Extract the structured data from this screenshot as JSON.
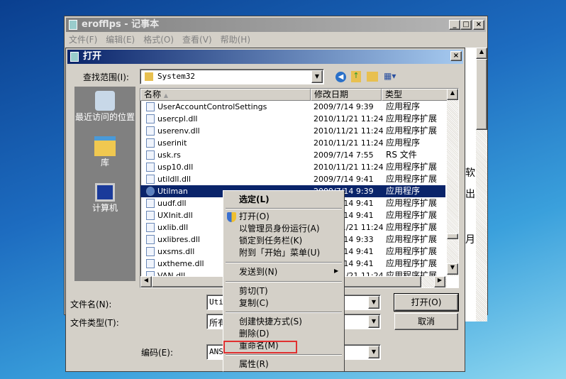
{
  "notepad": {
    "title": "erofflps - 记事本",
    "menu": [
      "文件(F)",
      "编辑(E)",
      "格式(O)",
      "查看(V)",
      "帮助(H)"
    ],
    "bg_text": [
      "软",
      "出",
      "月"
    ]
  },
  "dialog": {
    "title": "打开",
    "look_in_label": "查找范围(I):",
    "look_in_value": "System32",
    "places": [
      "最近访问的位置",
      "库",
      "计算机"
    ],
    "columns": [
      "名称",
      "修改日期",
      "类型"
    ],
    "files": [
      {
        "name": "UserAccountControlSettings",
        "date": "2009/7/14 9:39",
        "type": "应用程序",
        "icon": "uac-shield-icon"
      },
      {
        "name": "usercpl.dll",
        "date": "2010/11/21 11:24",
        "type": "应用程序扩展",
        "icon": "dll-icon"
      },
      {
        "name": "userenv.dll",
        "date": "2010/11/21 11:24",
        "type": "应用程序扩展",
        "icon": "dll-icon"
      },
      {
        "name": "userinit",
        "date": "2010/11/21 11:24",
        "type": "应用程序",
        "icon": "exe-icon"
      },
      {
        "name": "usk.rs",
        "date": "2009/7/14 7:55",
        "type": "RS 文件",
        "icon": "file-icon"
      },
      {
        "name": "usp10.dll",
        "date": "2010/11/21 11:24",
        "type": "应用程序扩展",
        "icon": "dll-icon"
      },
      {
        "name": "utildll.dll",
        "date": "2009/7/14 9:41",
        "type": "应用程序扩展",
        "icon": "dll-icon"
      },
      {
        "name": "Utilman",
        "date": "2009/7/14 9:39",
        "type": "应用程序",
        "icon": "utilman-icon"
      },
      {
        "name": "uudf.dll",
        "date": "2009/7/14 9:41",
        "type": "应用程序扩展",
        "icon": "dll-icon"
      },
      {
        "name": "UXInit.dll",
        "date": "2009/7/14 9:41",
        "type": "应用程序扩展",
        "icon": "dll-icon"
      },
      {
        "name": "uxlib.dll",
        "date": "2010/11/21 11:24",
        "type": "应用程序扩展",
        "icon": "dll-icon"
      },
      {
        "name": "uxlibres.dll",
        "date": "2009/7/14 9:33",
        "type": "应用程序扩展",
        "icon": "dll-icon"
      },
      {
        "name": "uxsms.dll",
        "date": "2009/7/14 9:41",
        "type": "应用程序扩展",
        "icon": "dll-icon"
      },
      {
        "name": "uxtheme.dll",
        "date": "2009/7/14 9:41",
        "type": "应用程序扩展",
        "icon": "dll-icon"
      },
      {
        "name": "VAN.dll",
        "date": "2010/11/21 11:24",
        "type": "应用程序扩展",
        "icon": "dll-icon"
      }
    ],
    "filename_label": "文件名(N):",
    "filename_value": "Utilman",
    "filetype_label": "文件类型(T):",
    "filetype_value": "所有文件",
    "encoding_label": "编码(E):",
    "encoding_value": "ANSI",
    "open_button": "打开(O)",
    "cancel_button": "取消"
  },
  "context_menu": {
    "items": [
      "选定(L)",
      "打开(O)",
      "以管理员身份运行(A)",
      "锁定到任务栏(K)",
      "附到「开始」菜单(U)",
      "发送到(N)",
      "剪切(T)",
      "复制(C)",
      "创建快捷方式(S)",
      "删除(D)",
      "重命名(M)",
      "属性(R)"
    ],
    "highlighted": "重命名(M)",
    "highlight_color": "#e03030"
  }
}
